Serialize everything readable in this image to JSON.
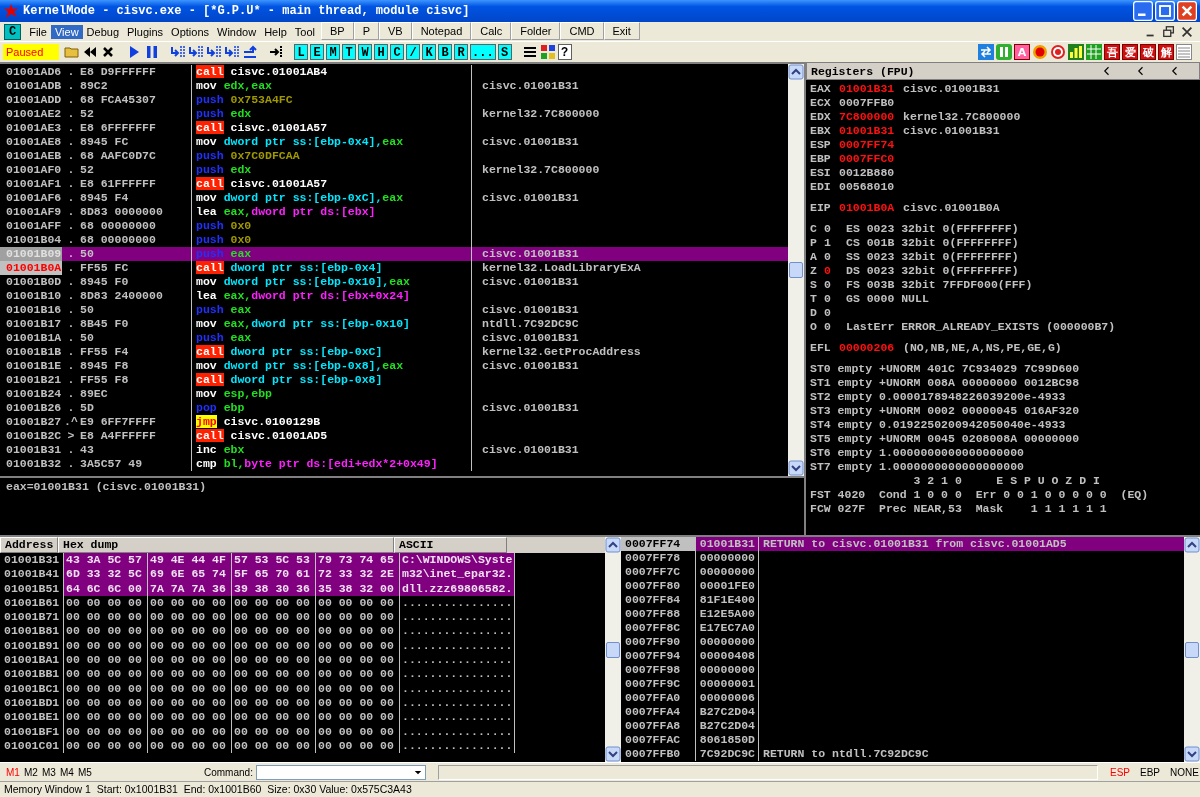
{
  "window": {
    "title": "KernelMode - cisvc.exe - [*G.P.U* - main thread, module cisvc]"
  },
  "menu": {
    "logo": "C",
    "items": [
      {
        "label": "File",
        "selected": false
      },
      {
        "label": "View",
        "selected": true
      },
      {
        "label": "Debug",
        "selected": false
      },
      {
        "label": "Plugins",
        "selected": false
      },
      {
        "label": "Options",
        "selected": false
      },
      {
        "label": "Window",
        "selected": false
      },
      {
        "label": "Help",
        "selected": false
      },
      {
        "label": "Tool",
        "selected": false
      }
    ],
    "quick_buttons": [
      "BP",
      "P",
      "VB",
      "Notepad",
      "Calc",
      "Folder",
      "CMD",
      "Exit"
    ]
  },
  "toolbar": {
    "status": "Paused",
    "window_buttons": [
      "L",
      "E",
      "M",
      "T",
      "W",
      "H",
      "C",
      "/",
      "K",
      "B",
      "R",
      "...",
      "S"
    ],
    "help": "?",
    "plugin_labels": [
      "A",
      "吾",
      "爱",
      "破",
      "解"
    ]
  },
  "disassembly": {
    "rows": [
      {
        "address": "01001AD6",
        "marker": ".",
        "hex": "E8 D9FFFFFF",
        "mnemonic": "call",
        "kind": "call",
        "operands": [
          {
            "text": "cisvc.01001AB4",
            "kind": "plain"
          }
        ],
        "selected": false,
        "current": false
      },
      {
        "address": "01001ADB",
        "marker": ".",
        "hex": "89C2",
        "mnemonic": "mov",
        "kind": "plain",
        "operands": [
          {
            "text": "edx,eax",
            "kind": "reg"
          }
        ],
        "comment": "cisvc.01001B31",
        "selected": false,
        "current": false
      },
      {
        "address": "01001ADD",
        "marker": ".",
        "hex": "68 FCA45307",
        "mnemonic": "push",
        "kind": "stack",
        "operands": [
          {
            "text": "0x753A4FC",
            "kind": "const"
          }
        ],
        "selected": false,
        "current": false
      },
      {
        "address": "01001AE2",
        "marker": ".",
        "hex": "52",
        "mnemonic": "push",
        "kind": "stack",
        "operands": [
          {
            "text": "edx",
            "kind": "reg"
          }
        ],
        "comment": "kernel32.7C800000",
        "selected": false,
        "current": false
      },
      {
        "address": "01001AE3",
        "marker": ".",
        "hex": "E8 6FFFFFFF",
        "mnemonic": "call",
        "kind": "call",
        "operands": [
          {
            "text": "cisvc.01001A57",
            "kind": "plain"
          }
        ],
        "selected": false,
        "current": false
      },
      {
        "address": "01001AE8",
        "marker": ".",
        "hex": "8945 FC",
        "mnemonic": "mov",
        "kind": "plain",
        "operands": [
          {
            "text": "dword ptr ss:[ebp-0x4],",
            "kind": "mem"
          },
          {
            "text": "eax",
            "kind": "reg"
          }
        ],
        "comment": "cisvc.01001B31",
        "selected": false,
        "current": false
      },
      {
        "address": "01001AEB",
        "marker": ".",
        "hex": "68 AAFC0D7C",
        "mnemonic": "push",
        "kind": "stack",
        "operands": [
          {
            "text": "0x7C0DFCAA",
            "kind": "const"
          }
        ],
        "selected": false,
        "current": false
      },
      {
        "address": "01001AF0",
        "marker": ".",
        "hex": "52",
        "mnemonic": "push",
        "kind": "stack",
        "operands": [
          {
            "text": "edx",
            "kind": "reg"
          }
        ],
        "comment": "kernel32.7C800000",
        "selected": false,
        "current": false
      },
      {
        "address": "01001AF1",
        "marker": ".",
        "hex": "E8 61FFFFFF",
        "mnemonic": "call",
        "kind": "call",
        "operands": [
          {
            "text": "cisvc.01001A57",
            "kind": "plain"
          }
        ],
        "selected": false,
        "current": false
      },
      {
        "address": "01001AF6",
        "marker": ".",
        "hex": "8945 F4",
        "mnemonic": "mov",
        "kind": "plain",
        "operands": [
          {
            "text": "dword ptr ss:[ebp-0xC],",
            "kind": "mem"
          },
          {
            "text": "eax",
            "kind": "reg"
          }
        ],
        "comment": "cisvc.01001B31",
        "selected": false,
        "current": false
      },
      {
        "address": "01001AF9",
        "marker": ".",
        "hex": "8D83 0000000",
        "mnemonic": "lea",
        "kind": "plain",
        "operands": [
          {
            "text": "eax,",
            "kind": "reg"
          },
          {
            "text": "dword ptr ds:[ebx]",
            "kind": "addr"
          }
        ],
        "selected": false,
        "current": false
      },
      {
        "address": "01001AFF",
        "marker": ".",
        "hex": "68 00000000",
        "mnemonic": "push",
        "kind": "stack",
        "operands": [
          {
            "text": "0x0",
            "kind": "const"
          }
        ],
        "selected": false,
        "current": false
      },
      {
        "address": "01001B04",
        "marker": ".",
        "hex": "68 00000000",
        "mnemonic": "push",
        "kind": "stack",
        "operands": [
          {
            "text": "0x0",
            "kind": "const"
          }
        ],
        "selected": false,
        "current": false
      },
      {
        "address": "01001B09",
        "marker": ".",
        "hex": "50",
        "mnemonic": "push",
        "kind": "stack",
        "operands": [
          {
            "text": "eax",
            "kind": "reg"
          }
        ],
        "comment": "cisvc.01001B31",
        "selected": true,
        "current": false
      },
      {
        "address": "01001B0A",
        "marker": ".",
        "hex": "FF55 FC",
        "mnemonic": "call",
        "kind": "call",
        "operands": [
          {
            "text": "dword ptr ss:[ebp-0x4]",
            "kind": "mem"
          }
        ],
        "comment": "kernel32.LoadLibraryExA",
        "selected": false,
        "current": true
      },
      {
        "address": "01001B0D",
        "marker": ".",
        "hex": "8945 F0",
        "mnemonic": "mov",
        "kind": "plain",
        "operands": [
          {
            "text": "dword ptr ss:[ebp-0x10],",
            "kind": "mem"
          },
          {
            "text": "eax",
            "kind": "reg"
          }
        ],
        "comment": "cisvc.01001B31",
        "selected": false,
        "current": false
      },
      {
        "address": "01001B10",
        "marker": ".",
        "hex": "8D83 2400000",
        "mnemonic": "lea",
        "kind": "plain",
        "operands": [
          {
            "text": "eax,",
            "kind": "reg"
          },
          {
            "text": "dword ptr ds:[ebx+0x24]",
            "kind": "addr"
          }
        ],
        "selected": false,
        "current": false
      },
      {
        "address": "01001B16",
        "marker": ".",
        "hex": "50",
        "mnemonic": "push",
        "kind": "stack",
        "operands": [
          {
            "text": "eax",
            "kind": "reg"
          }
        ],
        "comment": "cisvc.01001B31",
        "selected": false,
        "current": false
      },
      {
        "address": "01001B17",
        "marker": ".",
        "hex": "8B45 F0",
        "mnemonic": "mov",
        "kind": "plain",
        "operands": [
          {
            "text": "eax,",
            "kind": "reg"
          },
          {
            "text": "dword ptr ss:[ebp-0x10]",
            "kind": "mem"
          }
        ],
        "comment": "ntdll.7C92DC9C",
        "selected": false,
        "current": false
      },
      {
        "address": "01001B1A",
        "marker": ".",
        "hex": "50",
        "mnemonic": "push",
        "kind": "stack",
        "operands": [
          {
            "text": "eax",
            "kind": "reg"
          }
        ],
        "comment": "cisvc.01001B31",
        "selected": false,
        "current": false
      },
      {
        "address": "01001B1B",
        "marker": ".",
        "hex": "FF55 F4",
        "mnemonic": "call",
        "kind": "call",
        "operands": [
          {
            "text": "dword ptr ss:[ebp-0xC]",
            "kind": "mem"
          }
        ],
        "comment": "kernel32.GetProcAddress",
        "selected": false,
        "current": false
      },
      {
        "address": "01001B1E",
        "marker": ".",
        "hex": "8945 F8",
        "mnemonic": "mov",
        "kind": "plain",
        "operands": [
          {
            "text": "dword ptr ss:[ebp-0x8],",
            "kind": "mem"
          },
          {
            "text": "eax",
            "kind": "reg"
          }
        ],
        "comment": "cisvc.01001B31",
        "selected": false,
        "current": false
      },
      {
        "address": "01001B21",
        "marker": ".",
        "hex": "FF55 F8",
        "mnemonic": "call",
        "kind": "call",
        "operands": [
          {
            "text": "dword ptr ss:[ebp-0x8]",
            "kind": "mem"
          }
        ],
        "selected": false,
        "current": false
      },
      {
        "address": "01001B24",
        "marker": ".",
        "hex": "89EC",
        "mnemonic": "mov",
        "kind": "plain",
        "operands": [
          {
            "text": "esp,ebp",
            "kind": "reg"
          }
        ],
        "selected": false,
        "current": false
      },
      {
        "address": "01001B26",
        "marker": ".",
        "hex": "5D",
        "mnemonic": "pop",
        "kind": "stack",
        "operands": [
          {
            "text": "ebp",
            "kind": "reg"
          }
        ],
        "comment": "cisvc.01001B31",
        "selected": false,
        "current": false
      },
      {
        "address": "01001B27",
        "marker": ".^",
        "hex": "E9 6FF7FFFF",
        "mnemonic": "jmp",
        "kind": "jmp",
        "operands": [
          {
            "text": "cisvc.0100129B",
            "kind": "plain"
          }
        ],
        "selected": false,
        "current": false
      },
      {
        "address": "01001B2C",
        "marker": ">",
        "hex": "E8 A4FFFFFF",
        "mnemonic": "call",
        "kind": "call",
        "operands": [
          {
            "text": "cisvc.01001AD5",
            "kind": "plain"
          }
        ],
        "selected": false,
        "current": false
      },
      {
        "address": "01001B31",
        "marker": ".",
        "hex": "43",
        "mnemonic": "inc",
        "kind": "plain",
        "operands": [
          {
            "text": "ebx",
            "kind": "reg"
          }
        ],
        "comment": "cisvc.01001B31",
        "selected": false,
        "current": false
      },
      {
        "address": "01001B32",
        "marker": ".",
        "hex": "3A5C57 49",
        "mnemonic": "cmp",
        "kind": "plain",
        "operands": [
          {
            "text": "bl,",
            "kind": "reg"
          },
          {
            "text": "byte ptr ds:[edi+edx*2+0x49]",
            "kind": "addr"
          }
        ],
        "selected": false,
        "current": false
      }
    ],
    "info": "eax=01001B31 (cisvc.01001B31)"
  },
  "registers": {
    "title": "Registers (FPU)",
    "general": [
      {
        "name": "EAX",
        "value": "01001B31",
        "changed": true,
        "comment": "cisvc.01001B31"
      },
      {
        "name": "ECX",
        "value": "0007FFB0",
        "changed": false
      },
      {
        "name": "EDX",
        "value": "7C800000",
        "changed": true,
        "comment": "kernel32.7C800000"
      },
      {
        "name": "EBX",
        "value": "01001B31",
        "changed": true,
        "comment": "cisvc.01001B31"
      },
      {
        "name": "ESP",
        "value": "0007FF74",
        "changed": true
      },
      {
        "name": "EBP",
        "value": "0007FFC0",
        "changed": true
      },
      {
        "name": "ESI",
        "value": "0012B880",
        "changed": false
      },
      {
        "name": "EDI",
        "value": "00568010",
        "changed": false
      }
    ],
    "eip": {
      "name": "EIP",
      "value": "01001B0A",
      "changed": true,
      "comment": "cisvc.01001B0A"
    },
    "flags": [
      {
        "name": "C",
        "value": "0",
        "changed": false,
        "segment": "ES 0023 32bit 0(FFFFFFFF)"
      },
      {
        "name": "P",
        "value": "1",
        "changed": false,
        "segment": "CS 001B 32bit 0(FFFFFFFF)"
      },
      {
        "name": "A",
        "value": "0",
        "changed": false,
        "segment": "SS 0023 32bit 0(FFFFFFFF)"
      },
      {
        "name": "Z",
        "value": "0",
        "changed": true,
        "segment": "DS 0023 32bit 0(FFFFFFFF)"
      },
      {
        "name": "S",
        "value": "0",
        "changed": false,
        "segment": "FS 003B 32bit 7FFDF000(FFF)"
      },
      {
        "name": "T",
        "value": "0",
        "changed": false,
        "segment": "GS 0000 NULL"
      },
      {
        "name": "D",
        "value": "0",
        "changed": false
      },
      {
        "name": "O",
        "value": "0",
        "changed": false,
        "segment": "LastErr ERROR_ALREADY_EXISTS (000000B7)"
      }
    ],
    "efl": {
      "name": "EFL",
      "value": "00000206",
      "changed": true,
      "decoded": "(NO,NB,NE,A,NS,PE,GE,G)"
    },
    "fpu": [
      "ST0 empty +UNORM 401C 7C934029 7C99D600",
      "ST1 empty +UNORM 008A 00000000 0012BC98",
      "ST2 empty 0.0000178948226039200e-4933",
      "ST3 empty +UNORM 0002 00000045 016AF320",
      "ST4 empty 0.0192250200942050040e-4933",
      "ST5 empty +UNORM 0045 0208008A 00000000",
      "ST6 empty 1.0000000000000000000",
      "ST7 empty 1.0000000000000000000"
    ],
    "cond_bits": "3 2 1 0",
    "err_bits": "E S P U O Z D I",
    "fst": "FST 4020  Cond 1 0 0 0  Err 0 0 1 0 0 0 0 0  (EQ)",
    "fcw": "FCW 027F  Prec NEAR,53  Mask    1 1 1 1 1 1"
  },
  "dump": {
    "columns": [
      "Address",
      "Hex dump",
      "ASCII"
    ],
    "rows": [
      {
        "address": "01001B31",
        "hex": [
          "43 3A 5C 57",
          "49 4E 44 4F",
          "57 53 5C 53",
          "79 73 74 65"
        ],
        "ascii": "C:\\WINDOWS\\Syste",
        "selected": true
      },
      {
        "address": "01001B41",
        "hex": [
          "6D 33 32 5C",
          "69 6E 65 74",
          "5F 65 70 61",
          "72 33 32 2E"
        ],
        "ascii": "m32\\inet_epar32.",
        "selected": true
      },
      {
        "address": "01001B51",
        "hex": [
          "64 6C 6C 00",
          "7A 7A 7A 36",
          "39 38 30 36",
          "35 38 32 00"
        ],
        "ascii": "dll.zzz69806582.",
        "selected": true
      },
      {
        "address": "01001B61",
        "hex": [
          "00 00 00 00",
          "00 00 00 00",
          "00 00 00 00",
          "00 00 00 00"
        ],
        "ascii": "................",
        "selected": false
      },
      {
        "address": "01001B71",
        "hex": [
          "00 00 00 00",
          "00 00 00 00",
          "00 00 00 00",
          "00 00 00 00"
        ],
        "ascii": "................",
        "selected": false
      },
      {
        "address": "01001B81",
        "hex": [
          "00 00 00 00",
          "00 00 00 00",
          "00 00 00 00",
          "00 00 00 00"
        ],
        "ascii": "................",
        "selected": false
      },
      {
        "address": "01001B91",
        "hex": [
          "00 00 00 00",
          "00 00 00 00",
          "00 00 00 00",
          "00 00 00 00"
        ],
        "ascii": "................",
        "selected": false
      },
      {
        "address": "01001BA1",
        "hex": [
          "00 00 00 00",
          "00 00 00 00",
          "00 00 00 00",
          "00 00 00 00"
        ],
        "ascii": "................",
        "selected": false
      },
      {
        "address": "01001BB1",
        "hex": [
          "00 00 00 00",
          "00 00 00 00",
          "00 00 00 00",
          "00 00 00 00"
        ],
        "ascii": "................",
        "selected": false
      },
      {
        "address": "01001BC1",
        "hex": [
          "00 00 00 00",
          "00 00 00 00",
          "00 00 00 00",
          "00 00 00 00"
        ],
        "ascii": "................",
        "selected": false
      },
      {
        "address": "01001BD1",
        "hex": [
          "00 00 00 00",
          "00 00 00 00",
          "00 00 00 00",
          "00 00 00 00"
        ],
        "ascii": "................",
        "selected": false
      },
      {
        "address": "01001BE1",
        "hex": [
          "00 00 00 00",
          "00 00 00 00",
          "00 00 00 00",
          "00 00 00 00"
        ],
        "ascii": "................",
        "selected": false
      },
      {
        "address": "01001BF1",
        "hex": [
          "00 00 00 00",
          "00 00 00 00",
          "00 00 00 00",
          "00 00 00 00"
        ],
        "ascii": "................",
        "selected": false
      },
      {
        "address": "01001C01",
        "hex": [
          "00 00 00 00",
          "00 00 00 00",
          "00 00 00 00",
          "00 00 00 00"
        ],
        "ascii": "................",
        "selected": false
      }
    ]
  },
  "stack": {
    "rows": [
      {
        "address": "0007FF74",
        "value": "01001B31",
        "comment": "RETURN to cisvc.01001B31 from cisvc.01001AD5",
        "selected": true
      },
      {
        "address": "0007FF78",
        "value": "00000000",
        "selected": false
      },
      {
        "address": "0007FF7C",
        "value": "00000000",
        "selected": false
      },
      {
        "address": "0007FF80",
        "value": "00001FE0",
        "selected": false
      },
      {
        "address": "0007FF84",
        "value": "81F1E400",
        "selected": false
      },
      {
        "address": "0007FF88",
        "value": "E12E5A00",
        "selected": false
      },
      {
        "address": "0007FF8C",
        "value": "E17EC7A0",
        "selected": false
      },
      {
        "address": "0007FF90",
        "value": "00000000",
        "selected": false
      },
      {
        "address": "0007FF94",
        "value": "00000408",
        "selected": false
      },
      {
        "address": "0007FF98",
        "value": "00000000",
        "selected": false
      },
      {
        "address": "0007FF9C",
        "value": "00000001",
        "selected": false
      },
      {
        "address": "0007FFA0",
        "value": "00000006",
        "selected": false
      },
      {
        "address": "0007FFA4",
        "value": "B27C2D04",
        "selected": false
      },
      {
        "address": "0007FFA8",
        "value": "B27C2D04",
        "selected": false
      },
      {
        "address": "0007FFAC",
        "value": "8061850D",
        "selected": false
      },
      {
        "address": "0007FFB0",
        "value": "7C92DC9C",
        "comment": "RETURN to ntdll.7C92DC9C",
        "selected": false
      }
    ]
  },
  "command_bar": {
    "memory_buttons": [
      {
        "label": "M1",
        "selected": true
      },
      {
        "label": "M2",
        "selected": false
      },
      {
        "label": "M3",
        "selected": false
      },
      {
        "label": "M4",
        "selected": false
      },
      {
        "label": "M5",
        "selected": false
      }
    ],
    "command_label": "Command:",
    "register_buttons": [
      {
        "label": "ESP",
        "selected": true
      },
      {
        "label": "EBP",
        "selected": false
      },
      {
        "label": "NONE",
        "selected": false
      }
    ]
  },
  "status_bar": "Memory Window 1  Start: 0x1001B31  End: 0x1001B60  Size: 0x30 Value: 0x575C3A43"
}
